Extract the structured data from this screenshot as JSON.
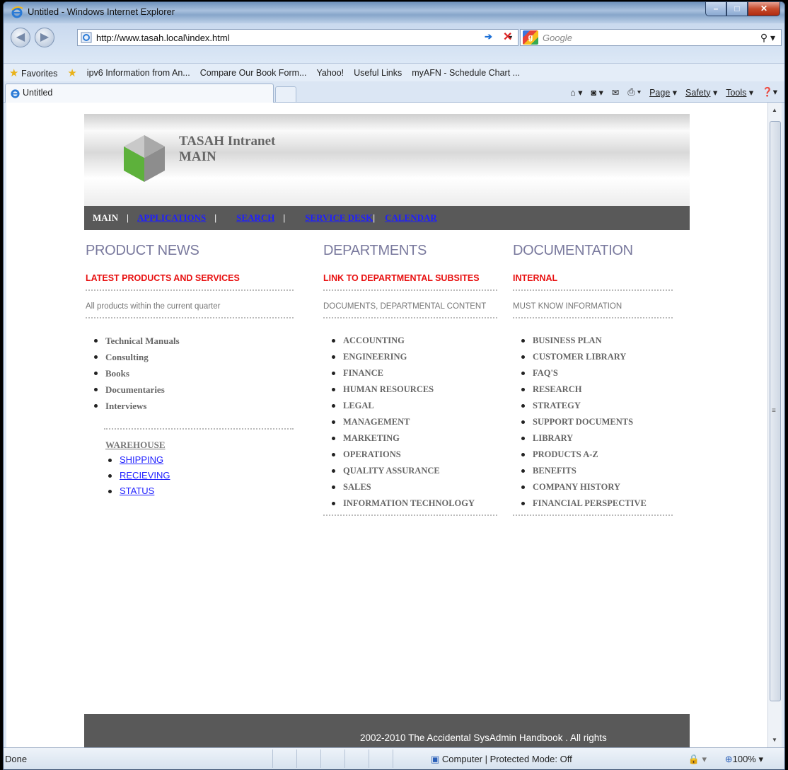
{
  "window": {
    "title": "Untitled - Windows Internet Explorer",
    "min": "–",
    "max": "□",
    "close": "✕"
  },
  "address": {
    "url": "http://www.tasah.local\\index.html",
    "search_placeholder": "Google"
  },
  "favorites": {
    "label": "Favorites",
    "items": [
      "ipv6 Information from An...",
      "Compare Our Book Form...",
      "Yahoo!",
      "Useful Links",
      "myAFN - Schedule Chart ..."
    ]
  },
  "tab": {
    "label": "Untitled"
  },
  "commands": {
    "page": "Page",
    "safety": "Safety",
    "tools": "Tools"
  },
  "site": {
    "title_line1": "TASAH Intranet",
    "title_line2": "MAIN",
    "menu": {
      "main": "MAIN",
      "applications": "APPLICATIONS",
      "search": "SEARCH",
      "service_desk": "SERVICE DESK",
      "calendar": "CALENDAR"
    },
    "product_news": {
      "heading": "PRODUCT NEWS",
      "subheading": "LATEST PRODUCTS AND SERVICES",
      "note": "All products within the current quarter",
      "items": [
        "Technical Manuals",
        "Consulting",
        "Books",
        "Documentaries",
        "Interviews"
      ],
      "warehouse": {
        "heading": "WAREHOUSE",
        "links": [
          "SHIPPING",
          "RECIEVING",
          "STATUS"
        ]
      }
    },
    "departments": {
      "heading": "DEPARTMENTS",
      "subheading": "LINK TO DEPARTMENTAL SUBSITES",
      "note": "DOCUMENTS, DEPARTMENTAL CONTENT",
      "items": [
        "ACCOUNTING",
        "ENGINEERING",
        "FINANCE",
        "HUMAN RESOURCES",
        "LEGAL",
        "MANAGEMENT",
        "MARKETING",
        "OPERATIONS",
        "QUALITY ASSURANCE",
        "SALES",
        "INFORMATION TECHNOLOGY"
      ]
    },
    "documentation": {
      "heading": "DOCUMENTATION",
      "subheading": "INTERNAL",
      "note": "MUST KNOW INFORMATION",
      "items": [
        "BUSINESS PLAN",
        "CUSTOMER LIBRARY",
        "FAQ'S",
        "RESEARCH",
        "STRATEGY",
        "SUPPORT DOCUMENTS",
        "LIBRARY",
        "PRODUCTS A-Z",
        "BENEFITS",
        "COMPANY HISTORY",
        "FINANCIAL PERSPECTIVE"
      ]
    },
    "footer": "2002-2010 The Accidental SysAdmin Handbook . All rights"
  },
  "status": {
    "left": "Done",
    "zone": "Computer | Protected Mode: Off",
    "zoom": "100%"
  }
}
